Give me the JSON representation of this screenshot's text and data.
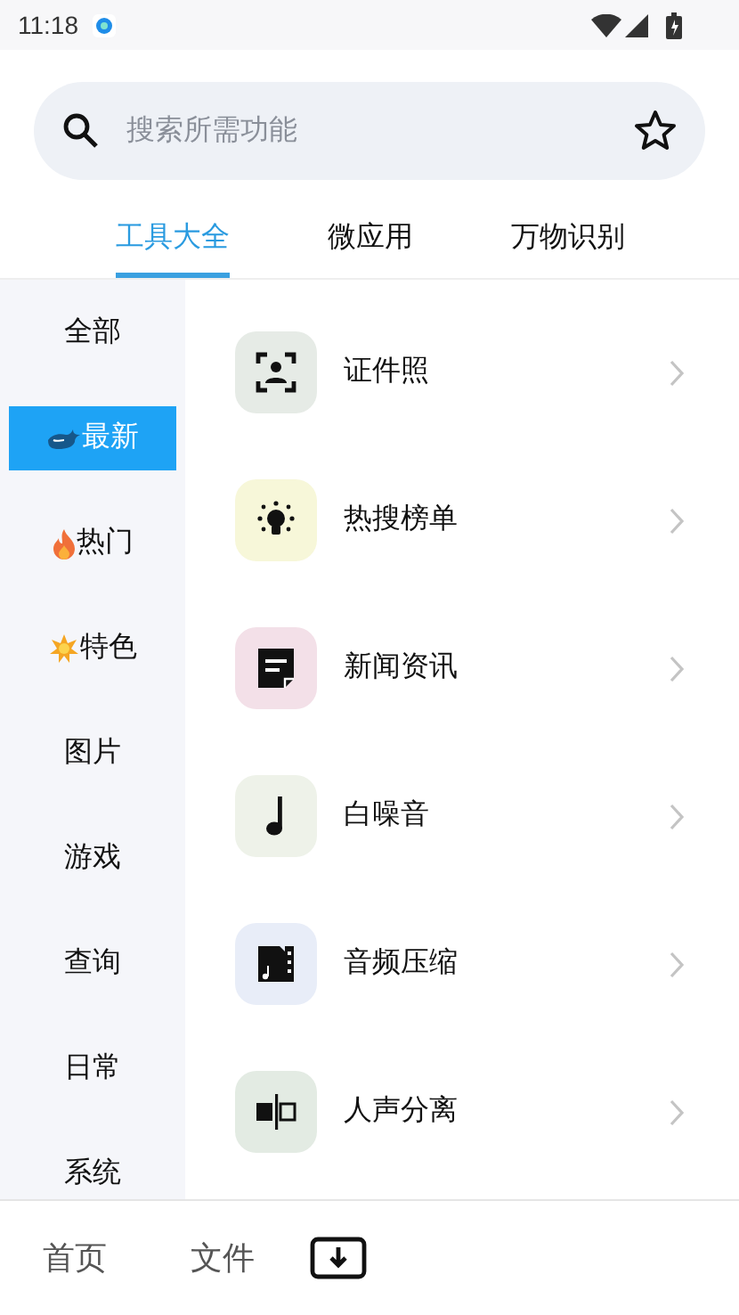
{
  "status_bar": {
    "time": "11:18"
  },
  "search": {
    "placeholder": "搜索所需功能"
  },
  "tabs": [
    {
      "label": "工具大全",
      "selected": true
    },
    {
      "label": "微应用",
      "selected": false
    },
    {
      "label": "万物识别",
      "selected": false
    }
  ],
  "sidebar": {
    "items": [
      {
        "label": "全部",
        "selected": false
      },
      {
        "label": "最新",
        "selected": true,
        "kind": "whale"
      },
      {
        "label": "热门",
        "selected": false,
        "kind": "fire"
      },
      {
        "label": "特色",
        "selected": false,
        "kind": "burst"
      },
      {
        "label": "图片",
        "selected": false
      },
      {
        "label": "游戏",
        "selected": false
      },
      {
        "label": "查询",
        "selected": false
      },
      {
        "label": "日常",
        "selected": false
      },
      {
        "label": "系统",
        "selected": false
      }
    ]
  },
  "tools": [
    {
      "label": "证件照",
      "kind": "portrait",
      "color": "#e6ebe6"
    },
    {
      "label": "热搜榜单",
      "kind": "bulb",
      "color": "#f7f7d9"
    },
    {
      "label": "新闻资讯",
      "kind": "note",
      "color": "#f3e0e8"
    },
    {
      "label": "白噪音",
      "kind": "music",
      "color": "#eef2e9"
    },
    {
      "label": "音频压缩",
      "kind": "audiofile",
      "color": "#e8edf8"
    },
    {
      "label": "人声分离",
      "kind": "split",
      "color": "#e3ebe3"
    }
  ],
  "bottom_nav": [
    {
      "label": "首页"
    },
    {
      "label": "文件"
    }
  ]
}
